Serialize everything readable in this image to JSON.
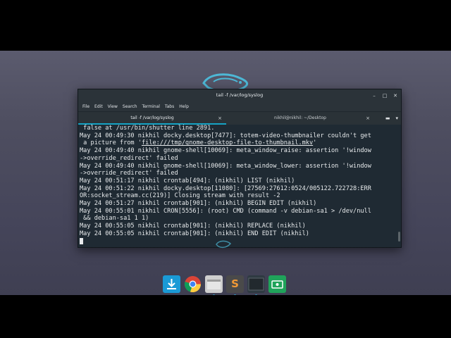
{
  "window": {
    "title": "tail -f /var/log/syslog"
  },
  "menu": [
    "File",
    "Edit",
    "View",
    "Search",
    "Terminal",
    "Tabs",
    "Help"
  ],
  "tabs": [
    {
      "label": "tail -f /var/log/syslog",
      "active": true
    },
    {
      "label": "nikhil@nikhil: ~/Desktop",
      "active": false
    }
  ],
  "terminal": {
    "lines": [
      [
        {
          "t": " false at /usr/bin/shutter line 2891."
        }
      ],
      [
        {
          "t": "May 24 00:49:30 nikhil docky.desktop[7477]: totem-video-thumbnailer couldn't get"
        }
      ],
      [
        {
          "t": " a picture from '"
        },
        {
          "t": "file:///tmp/gnome-desktop-file-to-thumbnail.mkv",
          "u": true
        },
        {
          "t": "'"
        }
      ],
      [
        {
          "t": "May 24 00:49:40 nikhil gnome-shell[10069]: meta_window_raise: assertion '!window"
        }
      ],
      [
        {
          "t": "->override_redirect' failed"
        }
      ],
      [
        {
          "t": "May 24 00:49:40 nikhil gnome-shell[10069]: meta_window_lower: assertion '!window"
        }
      ],
      [
        {
          "t": "->override_redirect' failed"
        }
      ],
      [
        {
          "t": "May 24 00:51:17 nikhil crontab[494]: (nikhil) LIST (nikhil)"
        }
      ],
      [
        {
          "t": "May 24 00:51:22 nikhil docky.desktop[11080]: [27569:27612:0524/005122.722728:ERR"
        }
      ],
      [
        {
          "t": "OR:socket_stream.cc(219)] Closing stream with result -2"
        }
      ],
      [
        {
          "t": "May 24 00:51:27 nikhil crontab[901]: (nikhil) BEGIN EDIT (nikhil)"
        }
      ],
      [
        {
          "t": "May 24 00:55:01 nikhil CRON[5556]: (root) CMD (command -v debian-sa1 > /dev/null"
        }
      ],
      [
        {
          "t": " && debian-sa1 1 1)"
        }
      ],
      [
        {
          "t": "May 24 00:55:05 nikhil crontab[901]: (nikhil) REPLACE (nikhil)"
        }
      ],
      [
        {
          "t": "May 24 00:55:05 nikhil crontab[901]: (nikhil) END EDIT (nikhil)"
        }
      ]
    ]
  },
  "dock": [
    {
      "icon": "download-icon",
      "color": "#1a9ad6"
    },
    {
      "icon": "chrome-icon",
      "color": "#ffffff"
    },
    {
      "icon": "files-icon",
      "color": "#c8c8c8"
    },
    {
      "icon": "sublime-icon",
      "color": "#4a4a4a"
    },
    {
      "icon": "terminal-icon",
      "color": "#2f3a42"
    },
    {
      "icon": "screen-recorder-icon",
      "color": "#1fa35a"
    }
  ],
  "dock_sublime_glyph": "S",
  "colors": {
    "accent": "#16a3c4",
    "terminal_bg": "#1f2a33",
    "desktop_bg": "#4e4e60"
  }
}
